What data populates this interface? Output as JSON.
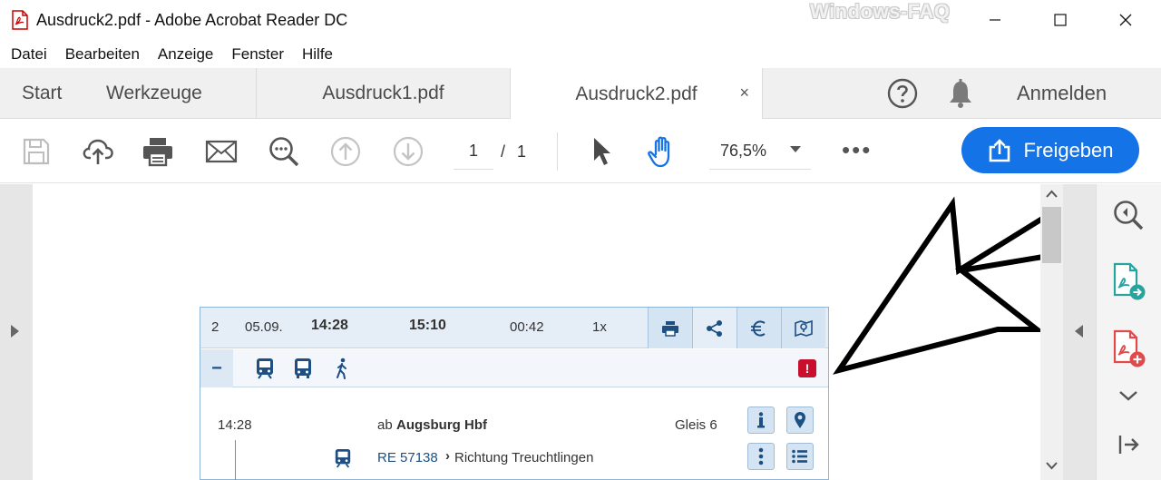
{
  "window": {
    "title": "Ausdruck2.pdf - Adobe Acrobat Reader DC",
    "watermark": "Windows-FAQ"
  },
  "menu": [
    "Datei",
    "Bearbeiten",
    "Anzeige",
    "Fenster",
    "Hilfe"
  ],
  "tabs": {
    "start": "Start",
    "tools": "Werkzeuge",
    "docs": [
      {
        "label": "Ausdruck1.pdf",
        "active": false
      },
      {
        "label": "Ausdruck2.pdf",
        "active": true,
        "close": "×"
      }
    ],
    "signin": "Anmelden"
  },
  "toolbar": {
    "page_current": "1",
    "page_sep": "/",
    "page_total": "1",
    "zoom": "76,5%",
    "more": "•••",
    "share_label": "Freigeben"
  },
  "journey": {
    "header": {
      "index": "2",
      "date": "05.09.",
      "dep": "14:28",
      "arr": "15:10",
      "duration": "00:42",
      "changes": "1x"
    },
    "row1": {
      "time": "14:28",
      "ab": "ab",
      "station": "Augsburg Hbf",
      "platform": "Gleis 6"
    },
    "row2": {
      "train": "RE 57138",
      "direction": "Richtung Treuchtlingen"
    }
  },
  "icons": [
    "pdf-file-icon",
    "minimize-icon",
    "maximize-icon",
    "close-icon",
    "help-icon",
    "bell-icon",
    "save-icon",
    "cloud-upload-icon",
    "print-icon",
    "mail-icon",
    "zoom-out-icon",
    "page-up-icon",
    "page-down-icon",
    "select-cursor-icon",
    "hand-tool-icon",
    "share-icon",
    "zoom-in-icon",
    "export-pdf-icon",
    "create-pdf-icon",
    "chevron-down-icon",
    "panel-collapse-icon",
    "train-icon",
    "bus-icon",
    "walk-icon",
    "info-icon",
    "location-pin-icon",
    "list-icon",
    "euro-icon",
    "map-icon",
    "warning-icon"
  ],
  "colors": {
    "accent": "#1473e6",
    "card_border": "#8fb4d6",
    "card_header": "#e5eef7",
    "warning": "#c8102e",
    "link_blue": "#1d4f82"
  }
}
